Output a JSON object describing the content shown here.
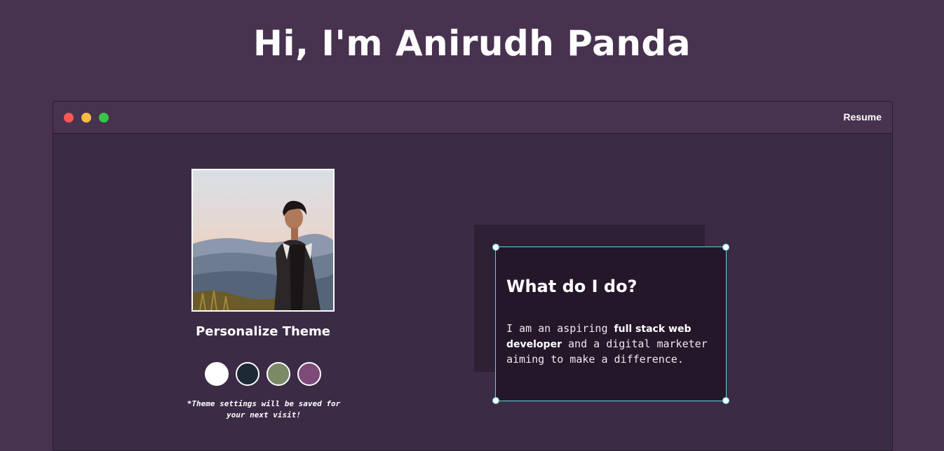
{
  "hero": {
    "title": "Hi, I'm Anirudh Panda"
  },
  "window": {
    "controls": [
      "close",
      "minimize",
      "maximize"
    ],
    "nav": {
      "resume_label": "Resume"
    }
  },
  "profile": {
    "photo_icon": "profile-photo"
  },
  "theme": {
    "title": "Personalize Theme",
    "swatches": [
      {
        "name": "light",
        "color": "#ffffff"
      },
      {
        "name": "blue",
        "color": "#1d2a36"
      },
      {
        "name": "green",
        "color": "#7a8a66"
      },
      {
        "name": "purple",
        "color": "#7d4a7a"
      }
    ],
    "note_line1": "*Theme settings will be saved for",
    "note_line2": "your next visit!"
  },
  "about": {
    "title": "What do I do?",
    "text_prefix": "I am an aspiring ",
    "text_bold": "full stack web developer",
    "text_suffix": " and a digital marketer aiming to make a difference."
  },
  "colors": {
    "background": "#47324f",
    "window_body": "#3b2b45",
    "card": "#24172a",
    "selection_border": "#5fd3e0"
  }
}
